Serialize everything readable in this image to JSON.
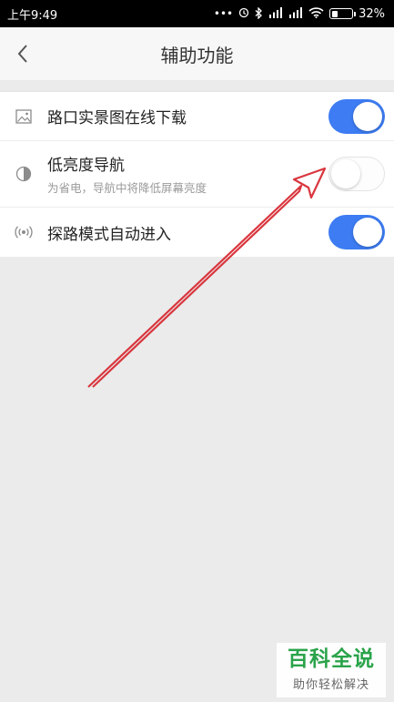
{
  "status_bar": {
    "time": "上午9:49",
    "dots": "•••",
    "battery_percent": "32%",
    "battery_level": 0.32
  },
  "header": {
    "title": "辅助功能"
  },
  "settings": [
    {
      "label": "路口实景图在线下载",
      "subtitle": "",
      "icon": "image-icon",
      "enabled": true
    },
    {
      "label": "低亮度导航",
      "subtitle": "为省电，导航中将降低屏幕亮度",
      "icon": "brightness-icon",
      "enabled": false
    },
    {
      "label": "探路模式自动进入",
      "subtitle": "",
      "icon": "radar-signal-icon",
      "enabled": true
    }
  ],
  "colors": {
    "toggle_on": "#3d7cf2",
    "annotation_arrow": "#d9363e",
    "watermark_green": "#2aa34a"
  },
  "watermark": {
    "title": "百科全说",
    "subtitle": "助你轻松解决"
  }
}
